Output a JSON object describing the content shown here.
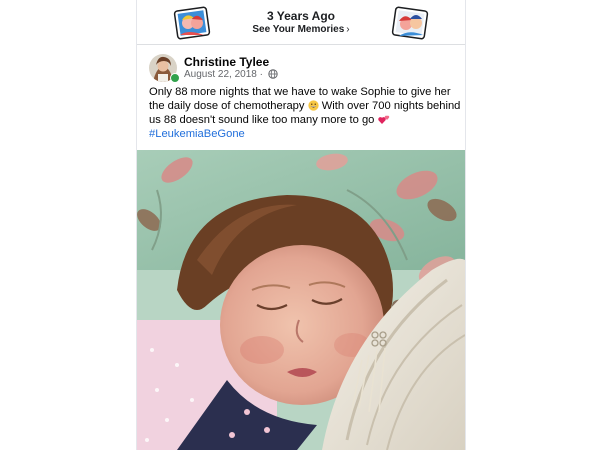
{
  "memories": {
    "title": "3 Years Ago",
    "link_label": "See Your Memories",
    "chevron": "›"
  },
  "post": {
    "author": "Christine Tylee",
    "date": "August 22, 2018",
    "separator": "·",
    "privacy_icon": "globe-icon",
    "text_lines": [
      "Only 88 more nights that we have to wake Sophie to give her",
      "the daily dose of chemotherapy",
      "With over 700 nights behind",
      "us 88 doesn't sound like too many more to go"
    ],
    "hashtag": "#LeukemiaBeGone",
    "emojis": [
      "grinning-face-emoji",
      "two-hearts-emoji"
    ]
  },
  "colors": {
    "hashtag": "#216fdb",
    "online": "#31a24c",
    "text": "#050505",
    "meta": "#65676b"
  }
}
